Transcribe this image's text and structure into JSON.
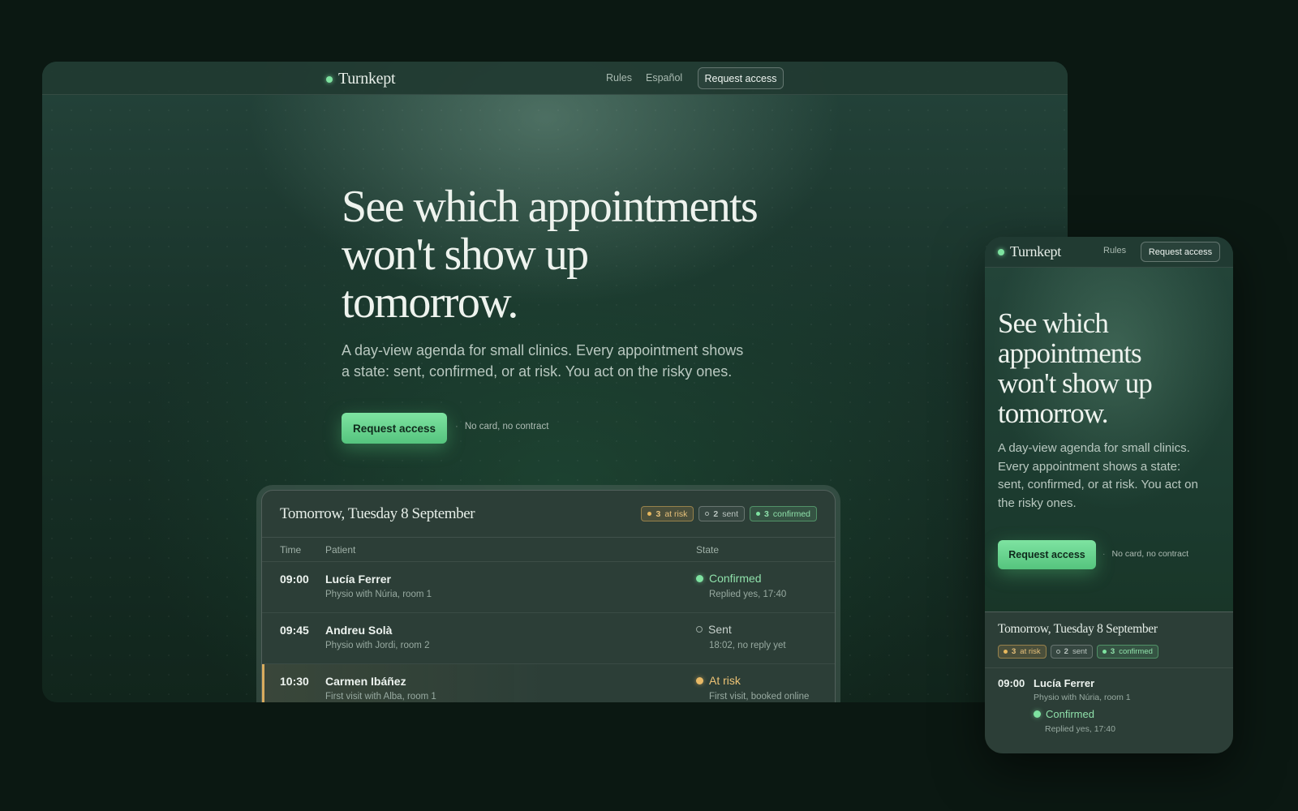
{
  "brand": {
    "name": "Turnkept",
    "accent": "#7ee2a0"
  },
  "nav": {
    "rules": "Rules",
    "language": "Español",
    "cta": "Request access"
  },
  "hero": {
    "title_lines": [
      "See which appointments",
      "won't show up",
      "tomorrow."
    ],
    "subtitle_lines": [
      "A day-view agenda for small clinics. Every appointment shows",
      "a state: sent, confirmed, or at risk. You act on the risky ones."
    ],
    "cta": "Request access",
    "cta_note": "No card, no contract"
  },
  "agenda": {
    "date": "Tomorrow, Tuesday 8 September",
    "summary": [
      {
        "count": "3",
        "label": "at risk",
        "kind": "risk"
      },
      {
        "count": "2",
        "label": "sent",
        "kind": "sent"
      },
      {
        "count": "3",
        "label": "confirmed",
        "kind": "confirmed"
      }
    ],
    "columns": {
      "time": "Time",
      "patient": "Patient",
      "state": "State"
    },
    "rows": [
      {
        "time": "09:00",
        "patient": "Lucía Ferrer",
        "detail": "Physio with Núria, room 1",
        "state": "Confirmed",
        "note": "Replied yes, 17:40",
        "kind": "confirmed"
      },
      {
        "time": "09:45",
        "patient": "Andreu Solà",
        "detail": "Physio with Jordi, room 2",
        "state": "Sent",
        "note": "18:02, no reply yet",
        "kind": "sent"
      },
      {
        "time": "10:30",
        "patient": "Carmen Ibáñez",
        "detail": "First visit with Alba, room 1",
        "state": "At risk",
        "note": "First visit, booked online",
        "kind": "risk"
      }
    ]
  },
  "mobile": {
    "title_lines": [
      "See which",
      "appointments",
      "won't show up",
      "tomorrow."
    ],
    "subtitle_lines": [
      "A day-view agenda for small clinics.",
      "Every appointment shows a state:",
      "sent, confirmed, or at risk. You act on",
      "the risky ones."
    ]
  },
  "colors": {
    "background": "#0b1812",
    "confirmed": "#7ee2a0",
    "at_risk": "#e8b966",
    "sent": "#95a39c"
  }
}
